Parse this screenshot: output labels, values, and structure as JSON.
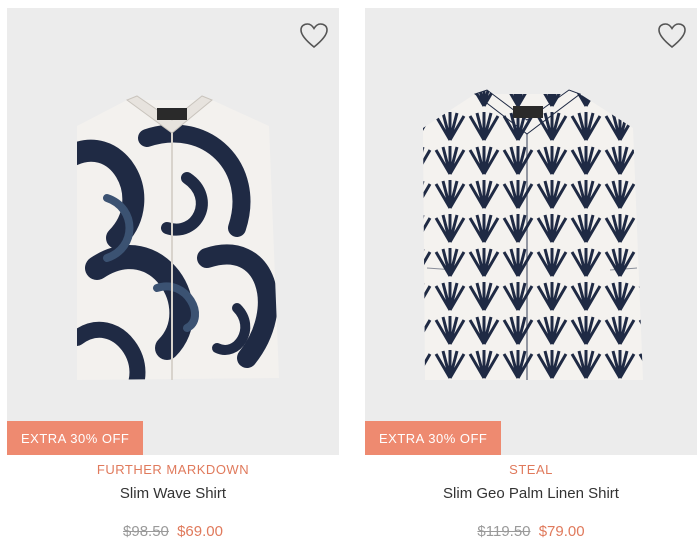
{
  "products": [
    {
      "badge": "EXTRA 30% OFF",
      "tagline": "FURTHER MARKDOWN",
      "name": "Slim Wave Shirt",
      "price_original": "$98.50",
      "price_sale": "$69.00",
      "wishlist_icon": "heart-outline-icon"
    },
    {
      "badge": "EXTRA 30% OFF",
      "tagline": "STEAL",
      "name": "Slim Geo Palm Linen Shirt",
      "price_original": "$119.50",
      "price_sale": "$79.00",
      "wishlist_icon": "heart-outline-icon"
    }
  ],
  "colors": {
    "accent": "#ee8a70",
    "accent_text": "#e07a5c",
    "image_bg": "#ececec",
    "print_navy": "#1f2a44"
  }
}
